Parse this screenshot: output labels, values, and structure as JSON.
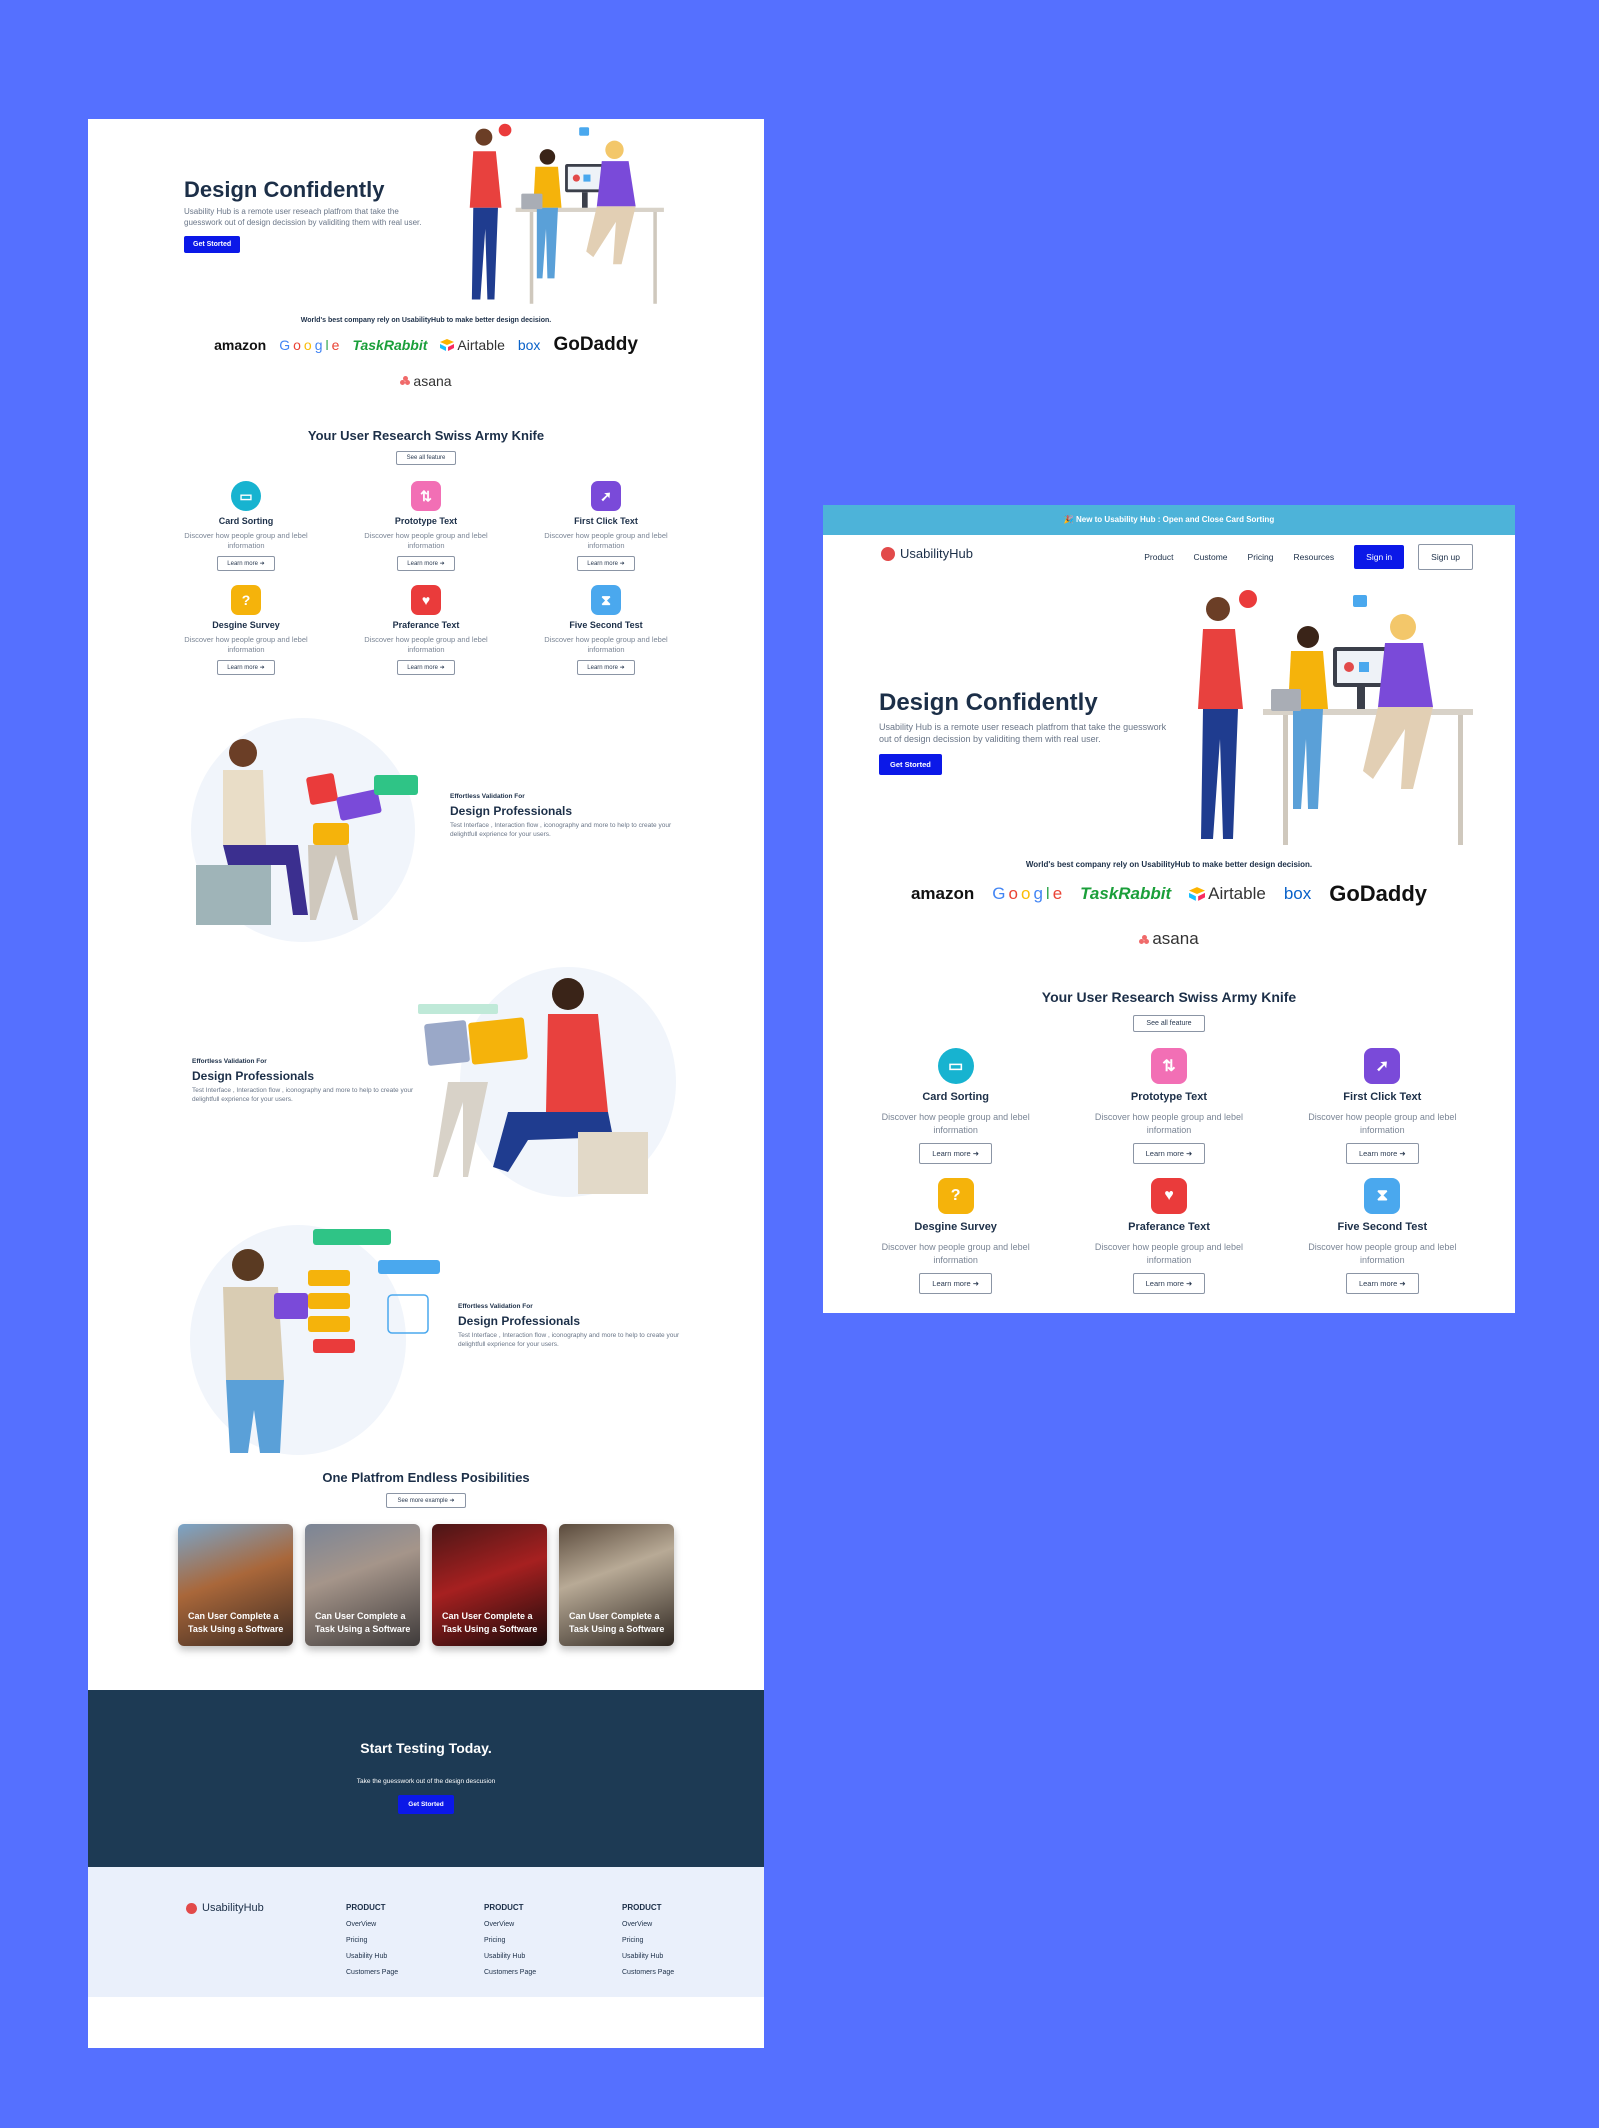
{
  "site": {
    "brand": "UsabilityHub",
    "banner": "🎉 New to Usability Hub : Open and Close Card Sorting",
    "nav": [
      "Product",
      "Custome",
      "Pricing",
      "Resources"
    ],
    "signin": "Sign in",
    "signup": "Sign up"
  },
  "hero": {
    "title": "Design Confidently",
    "text": "Usability Hub is a remote user reseach platfrom that take the guesswork out of design decission by validiting them with real user.",
    "cta": "Get Storted"
  },
  "trusted": {
    "text": "World's best company rely on UsabilityHub to make better design decision.",
    "logos": {
      "amazon": "amazon",
      "google": "Google",
      "taskrabbit": "TaskRabbit",
      "airtable": "Airtable",
      "box": "box",
      "godaddy": "GoDaddy",
      "asana": "asana"
    }
  },
  "features": {
    "title": "Your User Research Swiss Army Knife",
    "see_all": "See all feature",
    "learn_more": "Learn more ➜",
    "items": [
      {
        "title": "Card Sorting",
        "desc": "Discover how people group and lebel information",
        "color": "#17b3d0",
        "icon": "card-sorting-icon"
      },
      {
        "title": "Prototype Text",
        "desc": "Discover how people group and lebel information",
        "color": "#f26fb5",
        "icon": "prototype-icon"
      },
      {
        "title": "First Click Text",
        "desc": "Discover how people group and lebel information",
        "color": "#7a4ad9",
        "icon": "cursor-icon"
      },
      {
        "title": "Desgine Survey",
        "desc": "Discover how people group and lebel information",
        "color": "#f5b30b",
        "icon": "question-icon"
      },
      {
        "title": "Praferance Text",
        "desc": "Discover how people group and lebel information",
        "color": "#ea3b3b",
        "icon": "heart-icon"
      },
      {
        "title": "Five Second Test",
        "desc": "Discover how people group and lebel information",
        "color": "#4aa8ee",
        "icon": "hourglass-icon"
      }
    ]
  },
  "validation": [
    {
      "kicker": "Effortless Validation For",
      "title": "Design Professionals",
      "text": "Test Interface , Interaction flow , iconography and more to help to create your delightfull exprience for your users."
    },
    {
      "kicker": "Effortless Validation For",
      "title": "Design Professionals",
      "text": "Test Interface , Interaction flow , iconography and more to help to create your delightfull exprience for your users."
    },
    {
      "kicker": "Effortless Validation For",
      "title": "Design Professionals",
      "text": "Test Interface , Interaction flow , iconography and more to help to create your delightfull exprience for your users."
    }
  ],
  "platform": {
    "title": "One Platfrom Endless Posibilities",
    "see_more": "See more example ➜",
    "cards": [
      {
        "text": "Can User Complete a Task Using a Software"
      },
      {
        "text": "Can User Complete a Task Using a Software"
      },
      {
        "text": "Can User Complete a Task Using a Software"
      },
      {
        "text": "Can User Complete a Task Using a Software"
      }
    ]
  },
  "cta": {
    "title": "Start Testing Today.",
    "text": "Take the guesswork out of the design descusion",
    "button": "Get Storted"
  },
  "footer": {
    "brand": "UsabilityHub",
    "columns": [
      {
        "heading": "PRODUCT",
        "links": [
          "OverView",
          "Pricing",
          "Usability Hub",
          "Customers Page"
        ]
      },
      {
        "heading": "PRODUCT",
        "links": [
          "OverView",
          "Pricing",
          "Usability Hub",
          "Customers Page"
        ]
      },
      {
        "heading": "PRODUCT",
        "links": [
          "OverView",
          "Pricing",
          "Usability Hub",
          "Customers Page"
        ]
      }
    ]
  },
  "colors": {
    "background": "#5570ff",
    "primary": "#0b18e8",
    "navy": "#1d3a54",
    "banner": "#4db3d9"
  }
}
